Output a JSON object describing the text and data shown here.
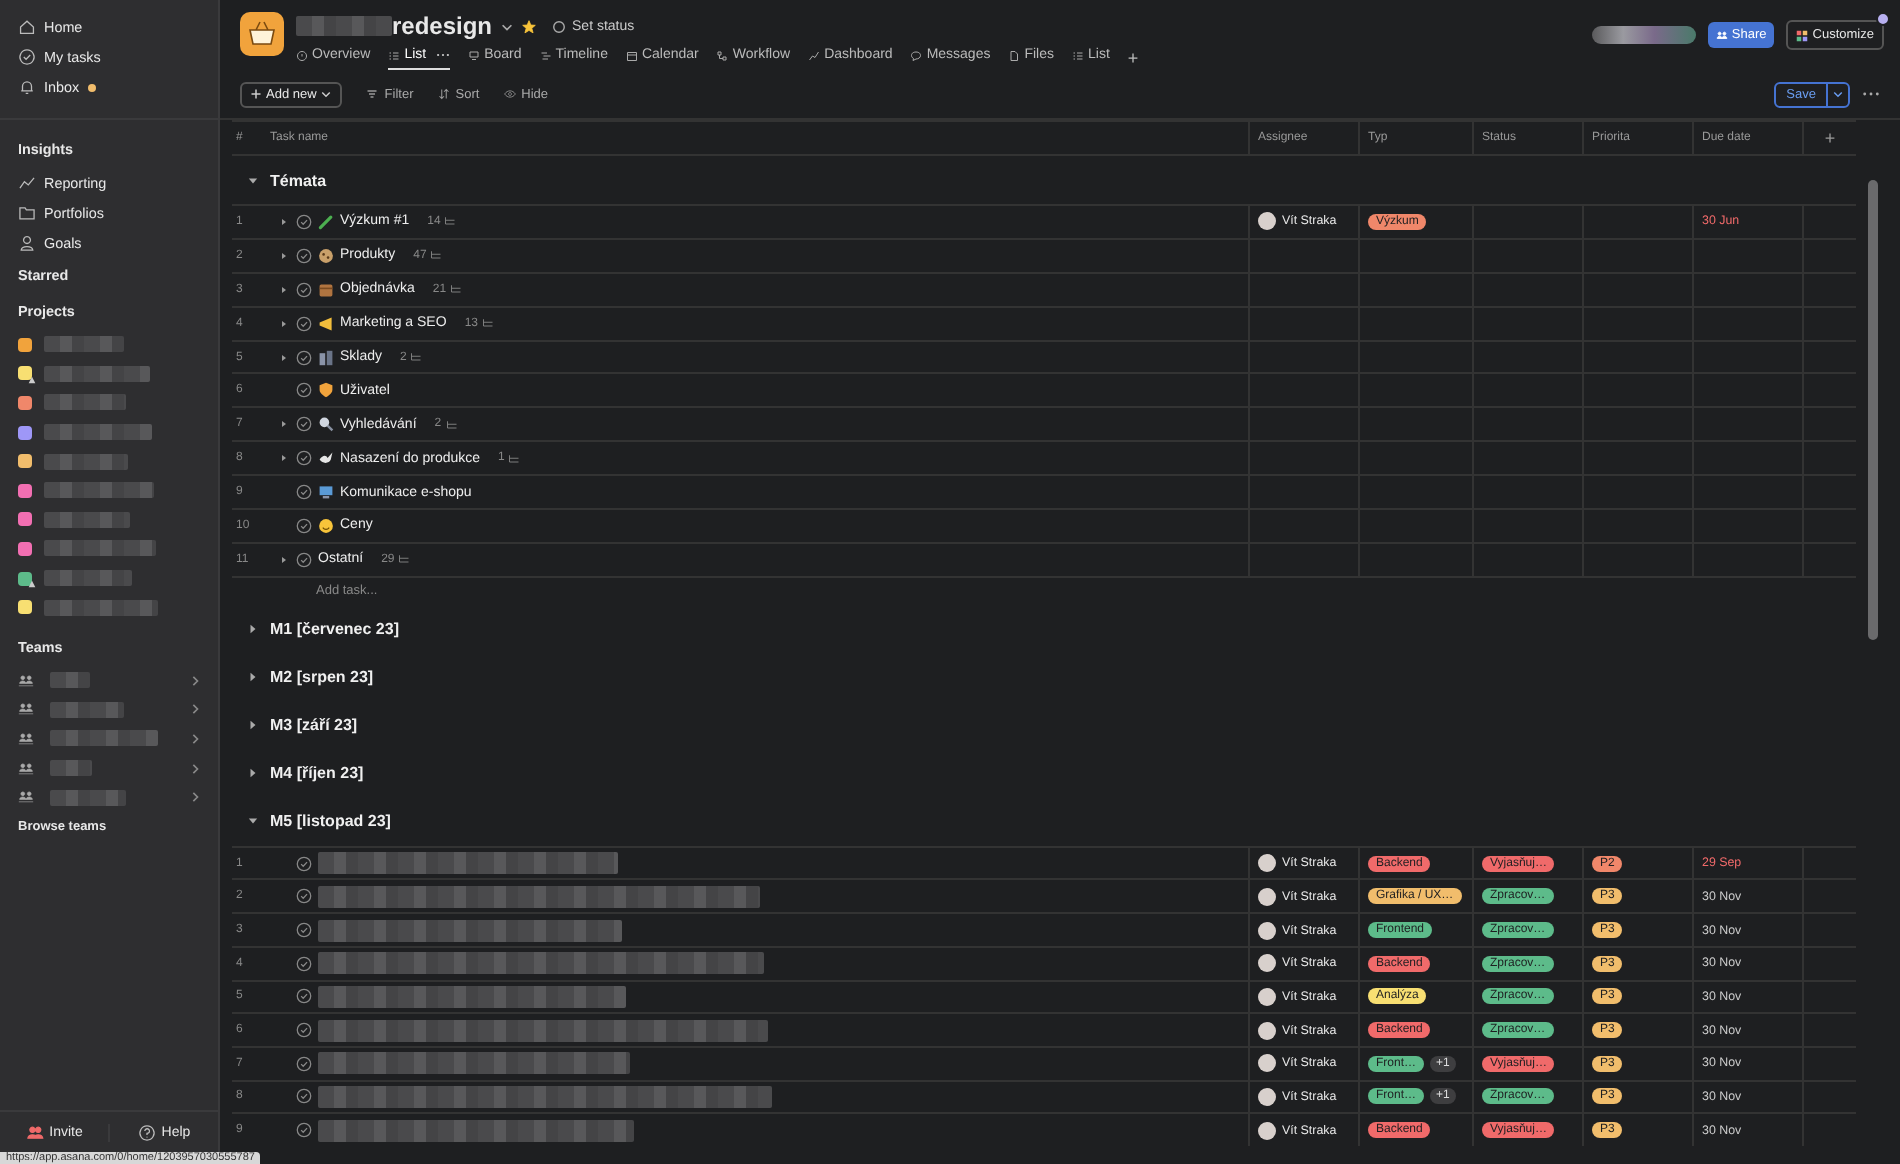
{
  "sidebar": {
    "nav": [
      {
        "label": "Home"
      },
      {
        "label": "My tasks"
      },
      {
        "label": "Inbox",
        "unread": true
      }
    ],
    "insights": {
      "title": "Insights",
      "items": [
        {
          "label": "Reporting"
        },
        {
          "label": "Portfolios"
        },
        {
          "label": "Goals"
        }
      ]
    },
    "starred": {
      "title": "Starred"
    },
    "projects": {
      "title": "Projects",
      "items": [
        {
          "color": "#f1a33c",
          "shared": false
        },
        {
          "color": "#f8df72",
          "shared": true
        },
        {
          "color": "#f0876a",
          "shared": false
        },
        {
          "color": "#9e97f7",
          "shared": false
        },
        {
          "color": "#f1bd6c",
          "shared": false
        },
        {
          "color": "#f26fb2",
          "shared": false
        },
        {
          "color": "#f26fb2",
          "shared": false
        },
        {
          "color": "#f26fb2",
          "shared": false
        },
        {
          "color": "#5dbb8a",
          "shared": true
        },
        {
          "color": "#f8df72",
          "shared": false
        }
      ]
    },
    "teams": {
      "title": "Teams",
      "items": [
        {
          "kind": "team"
        },
        {
          "kind": "team"
        },
        {
          "kind": "team"
        },
        {
          "kind": "team"
        },
        {
          "kind": "team"
        }
      ],
      "browse": "Browse teams"
    },
    "footer": [
      {
        "label": "Invite"
      },
      {
        "label": "Help"
      }
    ]
  },
  "status_url": "https://app.asana.com/0/home/1203957030555787",
  "header": {
    "title": "redesign",
    "starred": true,
    "status": "Set status",
    "tabs": [
      {
        "label": "Overview",
        "selected": false
      },
      {
        "label": "List",
        "selected": true
      },
      {
        "label": "Board",
        "selected": false
      },
      {
        "label": "Timeline",
        "selected": false
      },
      {
        "label": "Calendar",
        "selected": false
      },
      {
        "label": "Workflow",
        "selected": false
      },
      {
        "label": "Dashboard",
        "selected": false
      },
      {
        "label": "Messages",
        "selected": false
      },
      {
        "label": "Files",
        "selected": false
      },
      {
        "label": "List",
        "selected": false
      }
    ],
    "add_tab": "+",
    "share": "Share",
    "customize": "Customize",
    "customize_notice": true
  },
  "toolbar": {
    "add": "Add new",
    "filter": "Filter",
    "sort": "Sort",
    "hide": "Hide",
    "save": "Save"
  },
  "table": {
    "columns": [
      "#",
      "Task name",
      "Assignee",
      "Typ",
      "Status",
      "Priorita",
      "Due date",
      "+"
    ],
    "sections": [
      {
        "title": "Témata",
        "expanded": true,
        "add_task": "Add task...",
        "tasks": [
          {
            "number": "1",
            "name": "Výzkum #1",
            "expandable": true,
            "subtasks": "14",
            "assignee": "Vít Straka",
            "typ": {
              "label": "Výzkum",
              "color": "#f0876a"
            },
            "due": "30 Jun",
            "overdue": true
          },
          {
            "number": "2",
            "name": "Produkty",
            "expandable": true,
            "subtasks": "47"
          },
          {
            "number": "3",
            "name": "Objednávka",
            "expandable": true,
            "subtasks": "21"
          },
          {
            "number": "4",
            "name": "Marketing a SEO",
            "expandable": true,
            "subtasks": "13"
          },
          {
            "number": "5",
            "name": "Sklady",
            "expandable": true,
            "subtasks": "2"
          },
          {
            "number": "6",
            "name": "Uživatel",
            "expandable": false
          },
          {
            "number": "7",
            "name": "Vyhledávání",
            "expandable": true,
            "subtasks": "2"
          },
          {
            "number": "8",
            "name": "Nasazení do produkce",
            "expandable": true,
            "subtasks": "1"
          },
          {
            "number": "9",
            "name": "Komunikace e-shopu",
            "expandable": false
          },
          {
            "number": "10",
            "name": "Ceny",
            "expandable": false
          },
          {
            "number": "11",
            "name": "Ostatní",
            "expandable": true,
            "subtasks": "29"
          }
        ]
      },
      {
        "title": "M1 [červenec 23]",
        "expanded": false
      },
      {
        "title": "M2 [srpen 23]",
        "expanded": false
      },
      {
        "title": "M3 [září 23]",
        "expanded": false
      },
      {
        "title": "M4 [říjen 23]",
        "expanded": false
      },
      {
        "title": "M5 [listopad 23]",
        "expanded": true,
        "tasks": [
          {
            "number": "1",
            "assignee": "Vít Straka",
            "typ": {
              "label": "Backend",
              "color": "#f06a6a"
            },
            "status": {
              "label": "Vyjasňuj…",
              "color": "#f06a6a"
            },
            "priority": {
              "label": "P2",
              "color": "#f0876a"
            },
            "due": "29 Sep",
            "overdue": true
          },
          {
            "number": "2",
            "assignee": "Vít Straka",
            "typ": {
              "label": "Grafika / UX…",
              "color": "#f1bd6c"
            },
            "status": {
              "label": "Zpracov…",
              "color": "#5dbb8a"
            },
            "priority": {
              "label": "P3",
              "color": "#f1bd6c"
            },
            "due": "30 Nov",
            "overdue": false
          },
          {
            "number": "3",
            "assignee": "Vít Straka",
            "typ": {
              "label": "Frontend",
              "color": "#5dbb8a"
            },
            "status": {
              "label": "Zpracov…",
              "color": "#5dbb8a"
            },
            "priority": {
              "label": "P3",
              "color": "#f1bd6c"
            },
            "due": "30 Nov",
            "overdue": false
          },
          {
            "number": "4",
            "assignee": "Vít Straka",
            "typ": {
              "label": "Backend",
              "color": "#f06a6a"
            },
            "status": {
              "label": "Zpracov…",
              "color": "#5dbb8a"
            },
            "priority": {
              "label": "P3",
              "color": "#f1bd6c"
            },
            "due": "30 Nov",
            "overdue": false
          },
          {
            "number": "5",
            "assignee": "Vít Straka",
            "typ": {
              "label": "Analýza",
              "color": "#f8df72"
            },
            "status": {
              "label": "Zpracov…",
              "color": "#5dbb8a"
            },
            "priority": {
              "label": "P3",
              "color": "#f1bd6c"
            },
            "due": "30 Nov",
            "overdue": false
          },
          {
            "number": "6",
            "assignee": "Vít Straka",
            "typ": {
              "label": "Backend",
              "color": "#f06a6a"
            },
            "status": {
              "label": "Zpracov…",
              "color": "#5dbb8a"
            },
            "priority": {
              "label": "P3",
              "color": "#f1bd6c"
            },
            "due": "30 Nov",
            "overdue": false
          },
          {
            "number": "7",
            "assignee": "Vít Straka",
            "typ": {
              "label": "Front…",
              "color": "#5dbb8a"
            },
            "typ_more": "+1",
            "status": {
              "label": "Vyjasňuj…",
              "color": "#f06a6a"
            },
            "priority": {
              "label": "P3",
              "color": "#f1bd6c"
            },
            "due": "30 Nov",
            "overdue": false
          },
          {
            "number": "8",
            "assignee": "Vít Straka",
            "typ": {
              "label": "Front…",
              "color": "#5dbb8a"
            },
            "typ_more": "+1",
            "status": {
              "label": "Zpracov…",
              "color": "#5dbb8a"
            },
            "priority": {
              "label": "P3",
              "color": "#f1bd6c"
            },
            "due": "30 Nov",
            "overdue": false
          },
          {
            "number": "9",
            "assignee": "Vít Straka",
            "typ": {
              "label": "Backend",
              "color": "#f06a6a"
            },
            "status": {
              "label": "Vyjasňuj…",
              "color": "#f06a6a"
            },
            "priority": {
              "label": "P3",
              "color": "#f1bd6c"
            },
            "due": "30 Nov",
            "overdue": false
          }
        ]
      }
    ]
  }
}
